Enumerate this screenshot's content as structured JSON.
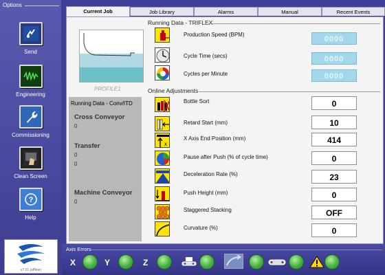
{
  "sidebar": {
    "title": "Options",
    "items": [
      {
        "label": "Send",
        "icon": "send-icon"
      },
      {
        "label": "Engineering",
        "icon": "waveform-icon"
      },
      {
        "label": "Commissioning",
        "icon": "wrench-icon"
      },
      {
        "label": "Clean Screen",
        "icon": "hand-cleaning-icon"
      },
      {
        "label": "Help",
        "icon": "help-icon"
      }
    ],
    "version": "v7.01 (offline)"
  },
  "tabs": [
    "Current Job",
    "Job Library",
    "Alarms",
    "Manual",
    "Recent Events"
  ],
  "active_tab": "Current Job",
  "profile_label": "PROFILE1",
  "running_data_triflex": {
    "title": "Running Data - TRIFLEX",
    "rows": [
      {
        "label": "Production Speed (BPM)",
        "value": "0000",
        "icon": "bottle-speed-icon"
      },
      {
        "label": "Cycle Time (secs)",
        "value": "0000",
        "icon": "clock-icon"
      },
      {
        "label": "Cycles per Minute",
        "value": "0000",
        "icon": "cycle-arrows-icon"
      }
    ]
  },
  "running_data_conv": {
    "title": "Running Data - Conv/ITD",
    "sections": [
      {
        "name": "Cross Conveyor",
        "values": [
          "0"
        ]
      },
      {
        "name": "Transfer",
        "values": [
          "0",
          "0"
        ]
      },
      {
        "name": "Machine Conveyor",
        "values": [
          "0"
        ]
      }
    ]
  },
  "online_adjustments": {
    "title": "Online Adjustments",
    "rows": [
      {
        "label": "Bottle Sort",
        "value": "0",
        "icon": "bottle-sort-icon"
      },
      {
        "label": "Retard Start (mm)",
        "value": "10",
        "icon": "retard-start-icon"
      },
      {
        "label": "X Axis End Position (mm)",
        "value": "414",
        "icon": "x-axis-end-icon"
      },
      {
        "label": "Pause after Push (% of cycle time)",
        "value": "0",
        "icon": "pie-pause-icon"
      },
      {
        "label": "Deceleration Rate (%)",
        "value": "23",
        "icon": "deceleration-icon"
      },
      {
        "label": "Push Height (mm)",
        "value": "0",
        "icon": "push-height-icon"
      },
      {
        "label": "Staggered Stacking",
        "value": "OFF",
        "icon": "staggered-stack-icon"
      },
      {
        "label": "Curvature (%)",
        "value": "0",
        "icon": "curvature-icon"
      }
    ]
  },
  "axis_errors": {
    "title": "Axis Errors",
    "axes": [
      "X",
      "Y",
      "Z"
    ]
  },
  "colors": {
    "sidebar": "#3f3f97",
    "icon_yellow": "#ffe400",
    "led_green": "#46b042",
    "readout_blue": "#a2d7ec"
  }
}
